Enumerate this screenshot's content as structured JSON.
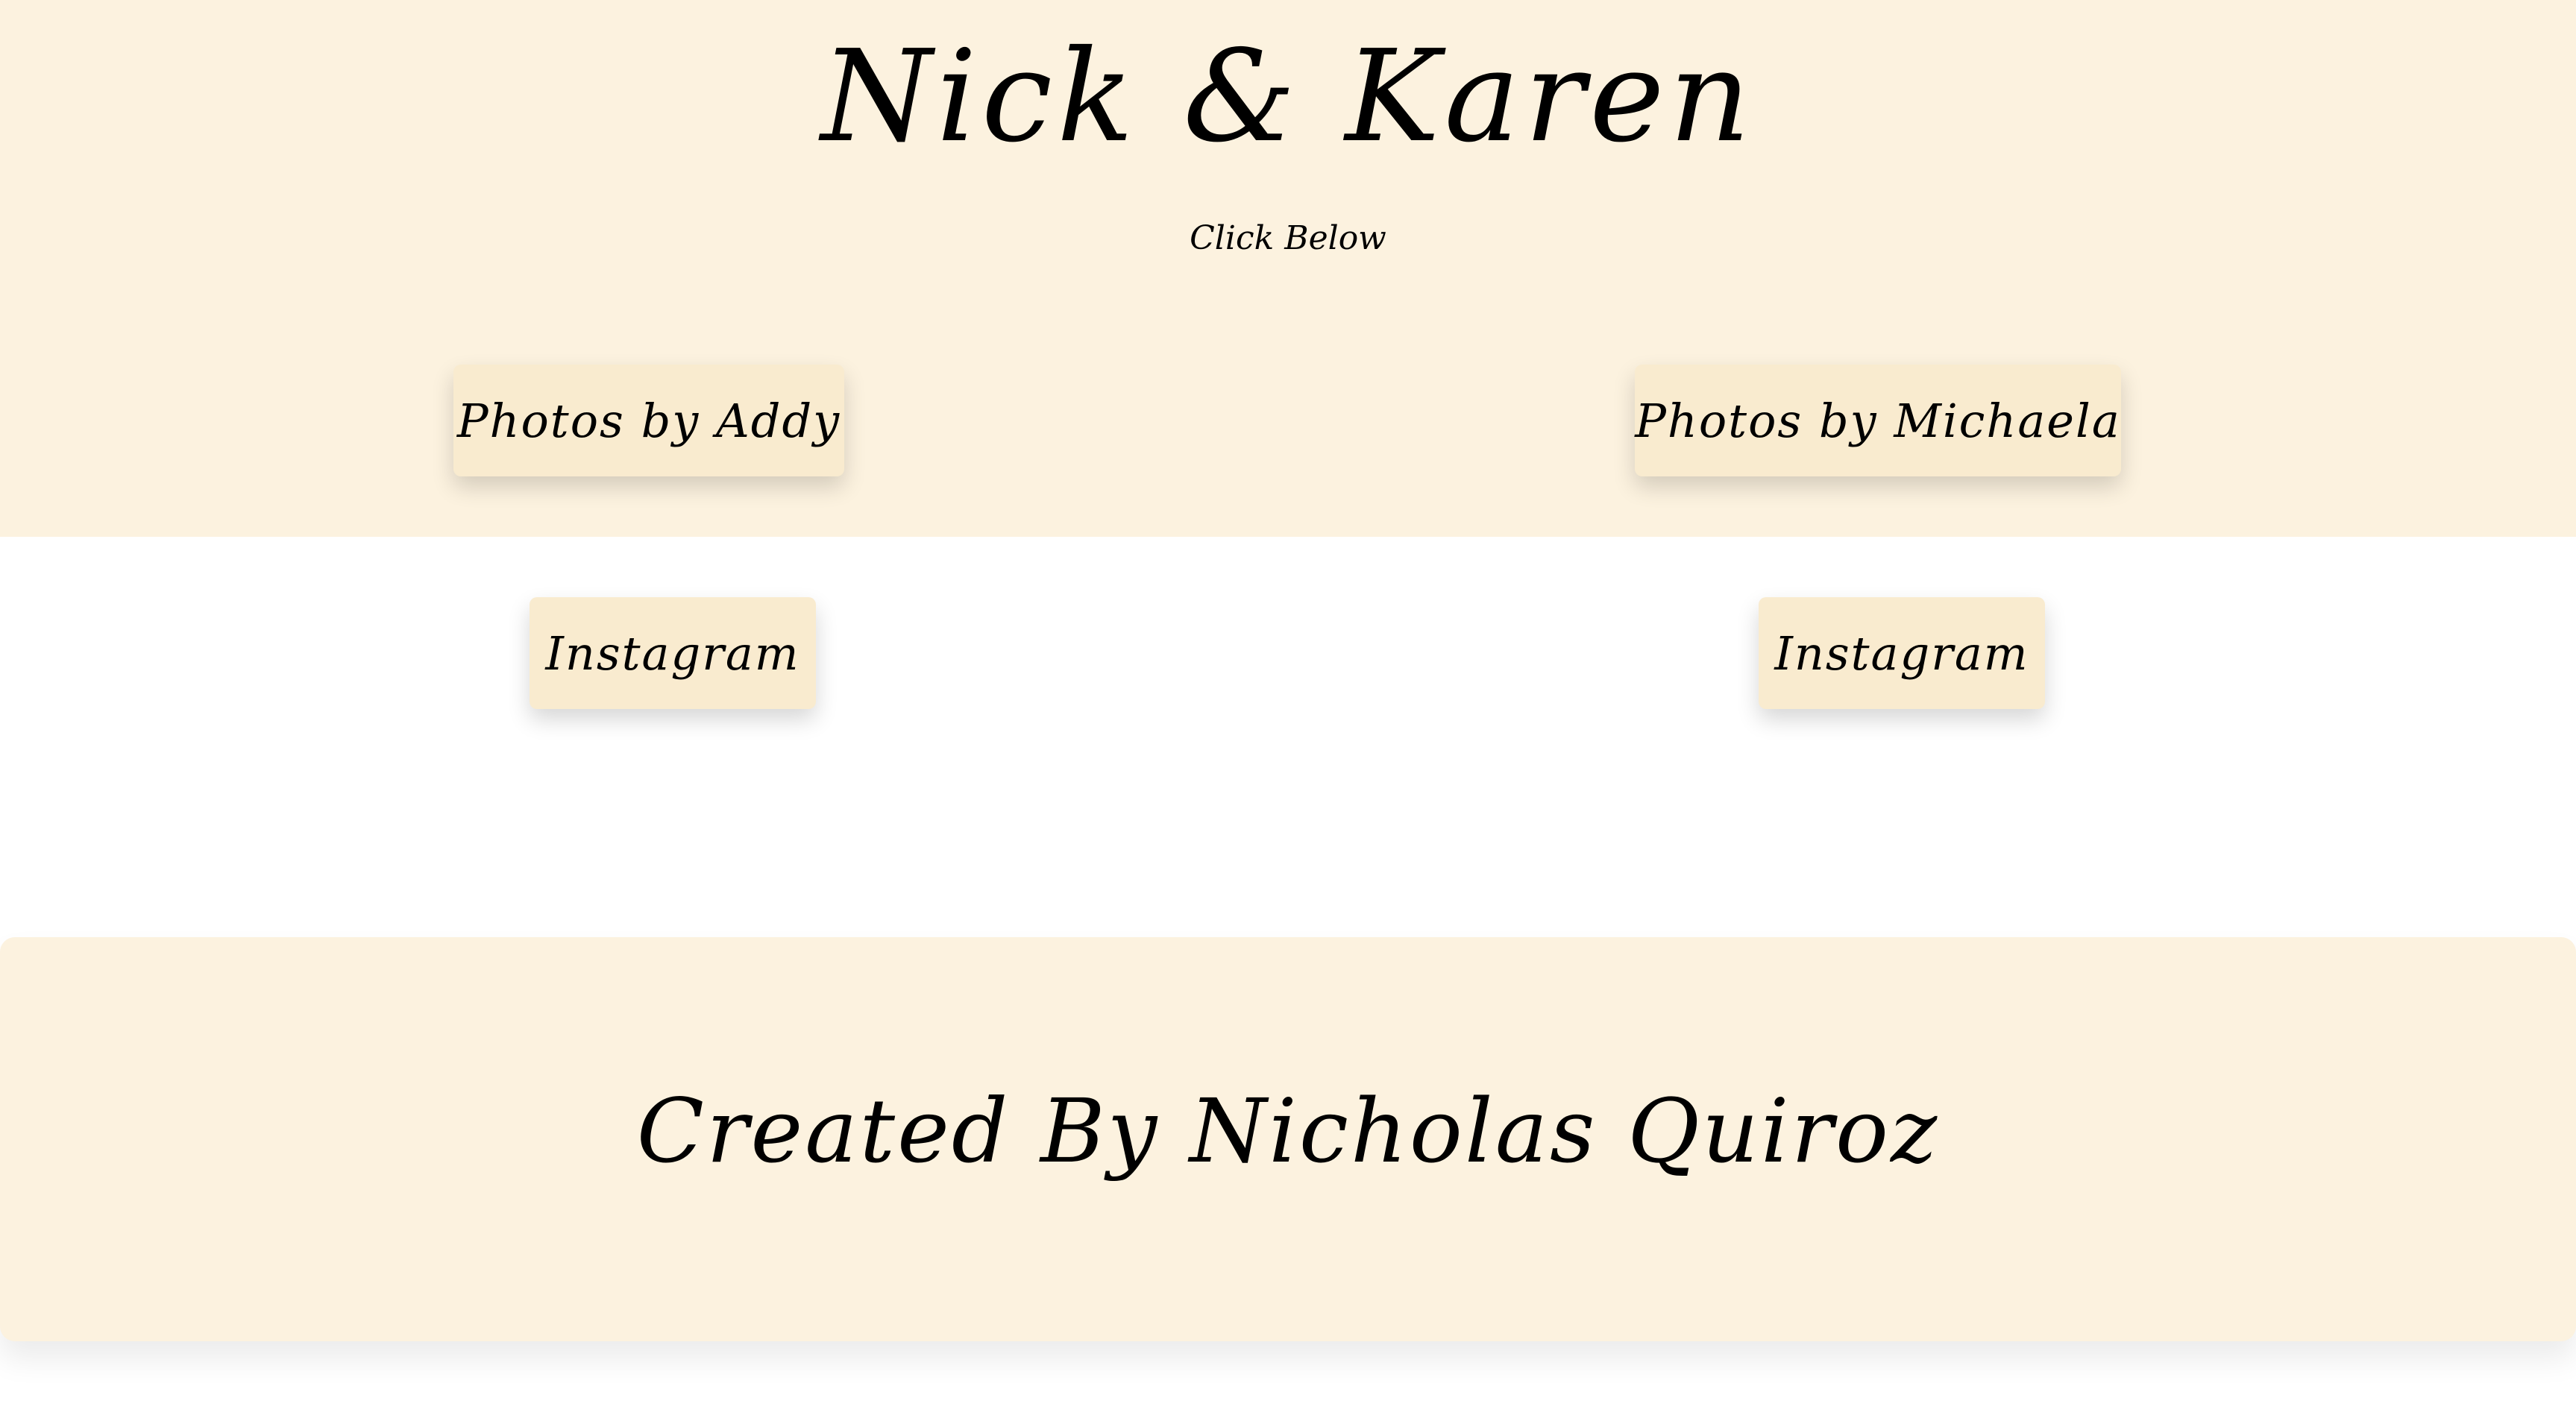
{
  "header": {
    "title": "Nick & Karen",
    "subtitle": "Click Below"
  },
  "buttons": {
    "photos_addy": "Photos by Addy",
    "photos_michaela": "Photos by Michaela",
    "instagram_left": "Instagram",
    "instagram_right": "Instagram"
  },
  "footer": {
    "credit": "Created By Nicholas Quiroz"
  },
  "colors": {
    "background_cream": "#fcf2df",
    "button_cream": "#f9ebcf",
    "page_white": "#ffffff",
    "text": "#000000"
  }
}
